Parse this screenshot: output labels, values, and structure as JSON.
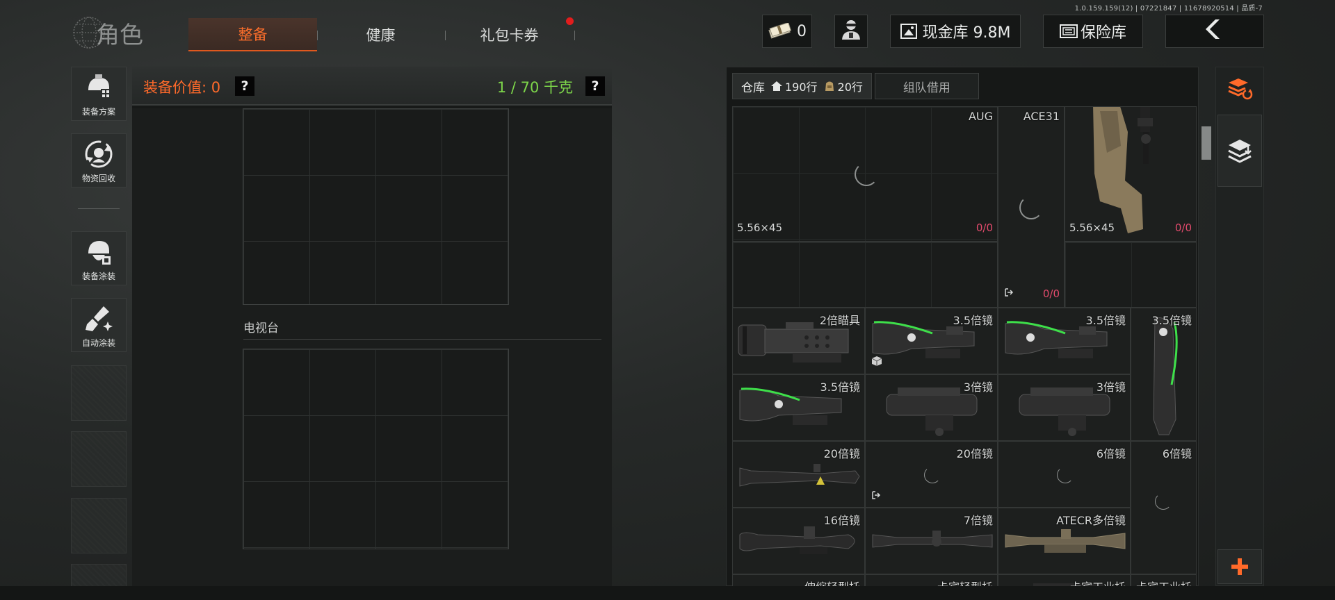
{
  "version": "1.0.159.159(12) | 07221847 | 11678920514 | 品质-7",
  "header": {
    "title": "角色",
    "tabs": [
      {
        "label": "整备",
        "active": true
      },
      {
        "label": "健康",
        "active": false
      },
      {
        "label": "礼包卡券",
        "active": false,
        "badge": true
      }
    ],
    "cash_count": "0",
    "vault_label": "现金库 9.8M",
    "safe_label": "保险库"
  },
  "sidebar": {
    "items": [
      {
        "label": "装备方案",
        "icon": "helmet-plan-icon"
      },
      {
        "label": "物资回收",
        "icon": "recycle-icon"
      },
      {
        "label": "装备涂装",
        "icon": "paint-helmet-icon"
      },
      {
        "label": "自动涂装",
        "icon": "auto-paint-icon"
      }
    ]
  },
  "equipment": {
    "value_label": "装备价值: 0",
    "weight_label": "1 / 70 千克",
    "help": "?",
    "tv_label": "电视台"
  },
  "warehouse": {
    "tab_main": "仓库",
    "rows_home": "190行",
    "rows_bag": "20行",
    "tab_team": "组队借用",
    "items": [
      {
        "name": "AUG",
        "caliber": "5.56×45",
        "count": "0/0"
      },
      {
        "name": "ACE31",
        "count": "0/0"
      },
      {
        "name": "",
        "caliber": "5.56×45",
        "count": "0/0"
      },
      {
        "name": "2倍瞄具"
      },
      {
        "name": "3.5倍镜"
      },
      {
        "name": "3.5倍镜"
      },
      {
        "name": "3.5倍镜"
      },
      {
        "name": "3.5倍镜"
      },
      {
        "name": "3倍镜"
      },
      {
        "name": "3倍镜"
      },
      {
        "name": "20倍镜"
      },
      {
        "name": "20倍镜"
      },
      {
        "name": "6倍镜"
      },
      {
        "name": "6倍镜"
      },
      {
        "name": "16倍镜"
      },
      {
        "name": "7倍镜"
      },
      {
        "name": "ATECR多倍镜"
      },
      {
        "name": "伸缩轻型托"
      },
      {
        "name": "卡宾轻型托"
      },
      {
        "name": "卡宾工业托"
      },
      {
        "name": "卡宾工业托"
      }
    ]
  },
  "colors": {
    "accent": "#ff6a2a",
    "weight_green": "#7dd64a",
    "count_red": "#e34b6d",
    "badge_red": "#e21d1d"
  }
}
